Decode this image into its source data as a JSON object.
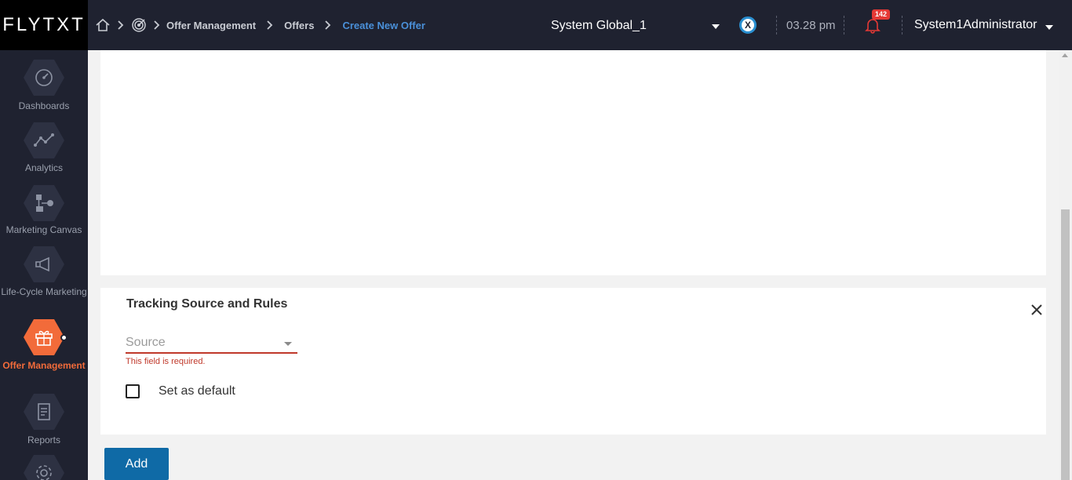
{
  "app": {
    "logo": "FLYTXT"
  },
  "breadcrumb": {
    "items": [
      "Offer Management",
      "Offers",
      "Create New Offer"
    ]
  },
  "header": {
    "scope": "System Global_1",
    "time": "03.28 pm",
    "notification_count": "142",
    "user": "System1Administrator"
  },
  "sidebar": {
    "items": [
      {
        "label": "Dashboards",
        "icon": "dashboard-gauge-icon"
      },
      {
        "label": "Analytics",
        "icon": "analytics-line-icon"
      },
      {
        "label": "Marketing Canvas",
        "icon": "canvas-flow-icon"
      },
      {
        "label": "Life-Cycle Marketing",
        "icon": "megaphone-icon"
      },
      {
        "label": "Offer Management",
        "icon": "gift-icon",
        "active": true
      },
      {
        "label": "Reports",
        "icon": "report-document-icon"
      },
      {
        "label": "",
        "icon": "settings-gear-icon"
      }
    ]
  },
  "tracking": {
    "title": "Tracking Source and Rules",
    "source_placeholder": "Source",
    "error": "This field is required.",
    "default_label": "Set as default"
  },
  "actions": {
    "add_label": "Add"
  },
  "colors": {
    "accent_orange": "#f26b3a",
    "link_blue": "#4a90d9",
    "error_red": "#c0392b",
    "primary_button": "#0f6aa6",
    "topbar": "#1f2230"
  }
}
